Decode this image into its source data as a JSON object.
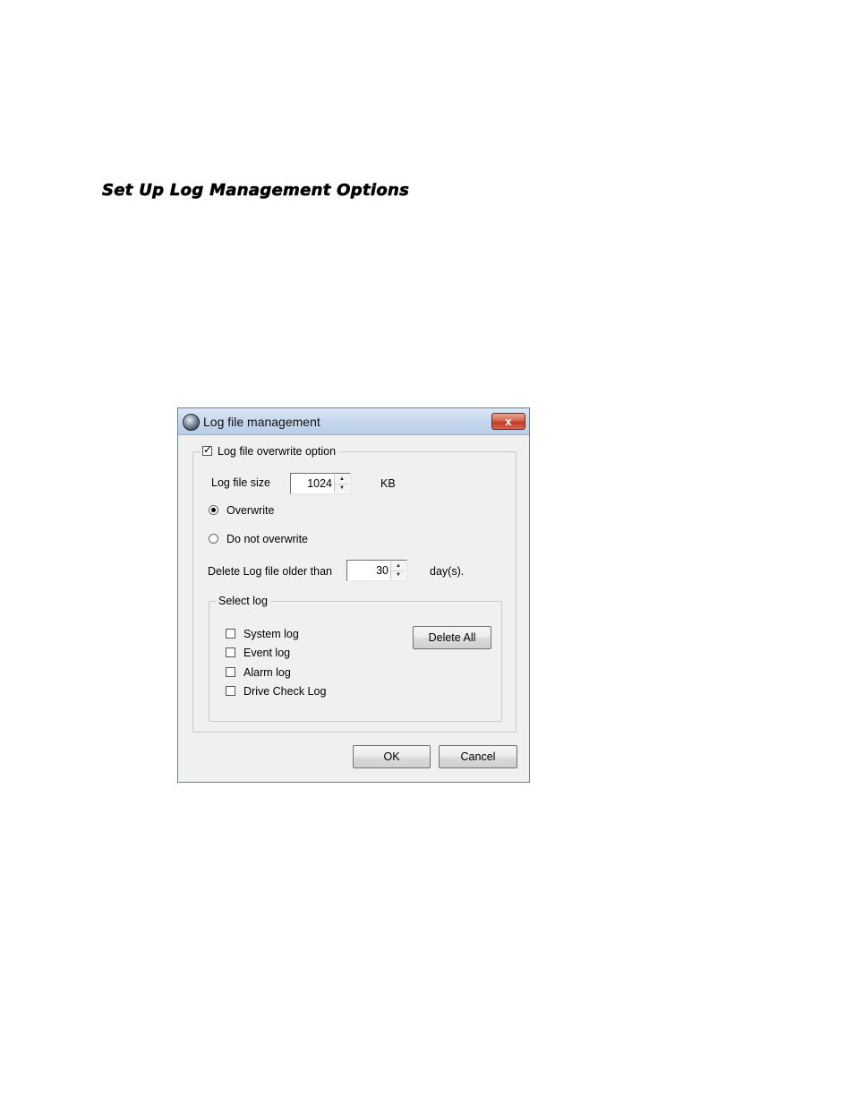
{
  "heading": "Set Up Log Management Options",
  "dialog": {
    "title": "Log file management",
    "close_label": "x",
    "overwrite_group": {
      "label": "Log file overwrite option",
      "checked": true,
      "log_file_size_label": "Log file size",
      "log_file_size_value": "1024",
      "log_file_size_unit": "KB",
      "radio_overwrite": "Overwrite",
      "radio_do_not_overwrite": "Do not overwrite",
      "delete_older_label": "Delete Log file older than",
      "delete_older_value": "30",
      "delete_older_unit": "day(s)."
    },
    "select_log": {
      "label": "Select log",
      "items": [
        "System log",
        "Event log",
        "Alarm log",
        "Drive Check Log"
      ],
      "delete_all": "Delete All"
    },
    "ok": "OK",
    "cancel": "Cancel"
  }
}
